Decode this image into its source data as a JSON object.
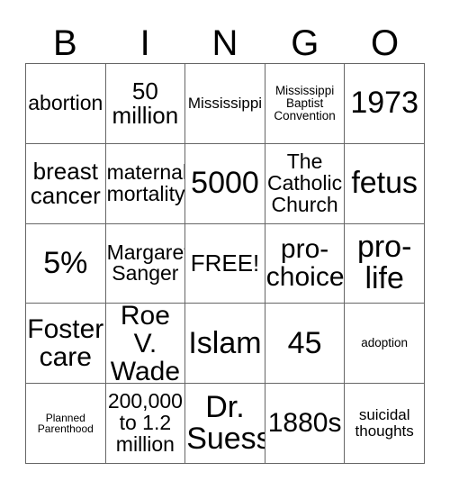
{
  "card": {
    "header_letters": [
      "B",
      "I",
      "N",
      "G",
      "O"
    ],
    "rows": [
      [
        {
          "text": "abortion",
          "size": "t-md"
        },
        {
          "text": "50\nmillion",
          "size": "t-lg"
        },
        {
          "text": "Mississippi",
          "size": "t-sm"
        },
        {
          "text": "Mississippi\nBaptist\nConvention",
          "size": "t-xs"
        },
        {
          "text": "1973",
          "size": "t-xxl"
        }
      ],
      [
        {
          "text": "breast\ncancer",
          "size": "t-lg"
        },
        {
          "text": "maternal\nmortality",
          "size": "t-md"
        },
        {
          "text": "5000",
          "size": "t-xxl"
        },
        {
          "text": "The\nCatholic\nChurch",
          "size": "t-md"
        },
        {
          "text": "fetus",
          "size": "t-xxl"
        }
      ],
      [
        {
          "text": "5%",
          "size": "t-xxl"
        },
        {
          "text": "Margaret\nSanger",
          "size": "t-md"
        },
        {
          "text": "FREE!",
          "size": "t-lg"
        },
        {
          "text": "pro-\nchoice",
          "size": "t-xl"
        },
        {
          "text": "pro-\nlife",
          "size": "t-xxl"
        }
      ],
      [
        {
          "text": "Foster\ncare",
          "size": "t-xl"
        },
        {
          "text": "Roe V.\nWade",
          "size": "t-xl"
        },
        {
          "text": "Islam",
          "size": "t-xxl"
        },
        {
          "text": "45",
          "size": "t-xxl"
        },
        {
          "text": "adoption",
          "size": "t-xs"
        }
      ],
      [
        {
          "text": "Planned\nParenthood",
          "size": "t-xxs"
        },
        {
          "text": "200,000\nto 1.2\nmillion",
          "size": "t-md"
        },
        {
          "text": "Dr.\nSuess",
          "size": "t-xxl"
        },
        {
          "text": "1880s",
          "size": "t-xl"
        },
        {
          "text": "suicidal\nthoughts",
          "size": "t-sm"
        }
      ]
    ]
  }
}
